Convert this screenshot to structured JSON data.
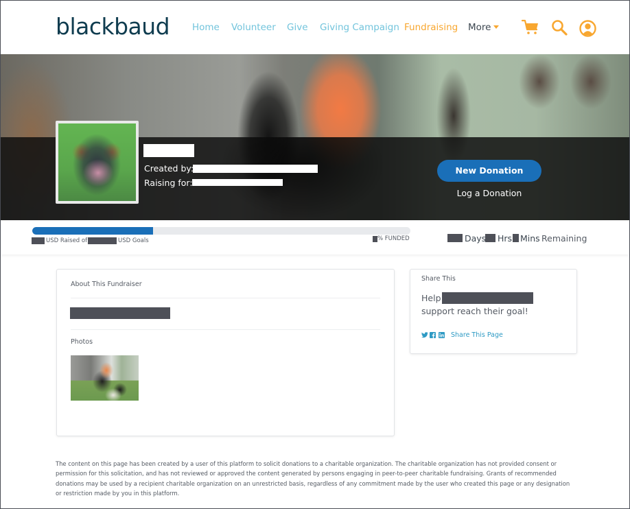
{
  "header": {
    "logo": "blackbaud",
    "nav": [
      {
        "label": "Home",
        "active": false
      },
      {
        "label": "Volunteer",
        "active": false
      },
      {
        "label": "Give",
        "active": false
      },
      {
        "label": "Giving Campaign",
        "active": false
      },
      {
        "label": "Fundraising",
        "active": true
      },
      {
        "label": "More",
        "active": false
      }
    ],
    "icons": [
      "cart-icon",
      "search-icon",
      "user-account-icon"
    ],
    "colors": {
      "logo": "#0f3c4f",
      "nav_link": "#72c4dc",
      "nav_active": "#f8a730",
      "icon": "#f8a730"
    }
  },
  "hero": {
    "fundraiser_name": "[redacted]",
    "created_by_label": "Created by:",
    "created_by_value": "[redacted]",
    "raising_for_label": "Raising for:",
    "raising_for_value": "[redacted]",
    "new_donation_label": "New Donation",
    "log_donation_label": "Log a Donation",
    "accent": "#1a6fb8"
  },
  "progress": {
    "funded_fraction": 0.32,
    "raised_value": "[redacted]",
    "raised_label": "USD Raised of",
    "goal_value": "[redacted]",
    "goal_label": "USD Goals",
    "percent_value": "[redacted]",
    "percent_label": "% FUNDED",
    "days_label": "Days",
    "hrs_label": "Hrs",
    "mins_label": "Mins",
    "remaining_label": "Remaining"
  },
  "about": {
    "title": "About This Fundraiser",
    "body": "[redacted]",
    "photos_title": "Photos",
    "photos": [
      "volunteer-with-dogs-photo"
    ]
  },
  "share": {
    "title": "Share This",
    "line1_prefix": "Help",
    "line1_name": "[redacted]",
    "line2": "support reach their goal!",
    "social_icons": [
      "twitter-icon",
      "facebook-icon",
      "linkedin-icon"
    ],
    "share_link": "Share This Page"
  },
  "disclaimer": "The content on this page has been created by a user of this platform to solicit donations to a charitable organization. The charitable organization has not provided consent or permission for this solicitation, and has not reviewed or approved the content generated by persons engaging in peer-to-peer charitable fundraising. Grants of recommended donations may be used by a recipient charitable organization on an unrestricted basis, regardless of any commitment made by the user who created this page or any designation or restriction made by you in this platform."
}
